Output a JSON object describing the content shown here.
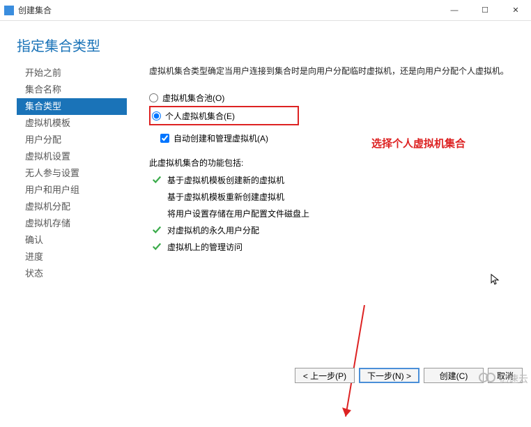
{
  "titlebar": {
    "title": "创建集合"
  },
  "winControls": {
    "min": "—",
    "max": "☐",
    "close": "✕"
  },
  "header": {
    "title": "指定集合类型"
  },
  "nav": {
    "items": [
      {
        "label": "开始之前"
      },
      {
        "label": "集合名称"
      },
      {
        "label": "集合类型"
      },
      {
        "label": "虚拟机模板"
      },
      {
        "label": "用户分配"
      },
      {
        "label": "虚拟机设置"
      },
      {
        "label": "无人参与设置"
      },
      {
        "label": "用户和用户组"
      },
      {
        "label": "虚拟机分配"
      },
      {
        "label": "虚拟机存储"
      },
      {
        "label": "确认"
      },
      {
        "label": "进度"
      },
      {
        "label": "状态"
      }
    ],
    "activeIndex": 2
  },
  "content": {
    "desc": "虚拟机集合类型确定当用户连接到集合时是向用户分配临时虚拟机，还是向用户分配个人虚拟机。",
    "radio1": "虚拟机集合池(O)",
    "radio2": "个人虚拟机集合(E)",
    "checkbox": "自动创建和管理虚拟机(A)",
    "featuresTitle": "此虚拟机集合的功能包括:",
    "features": [
      {
        "tick": true,
        "text": "基于虚拟机模板创建新的虚拟机"
      },
      {
        "tick": false,
        "text": "基于虚拟机模板重新创建虚拟机"
      },
      {
        "tick": false,
        "text": "将用户设置存储在用户配置文件磁盘上"
      },
      {
        "tick": true,
        "text": "对虚拟机的永久用户分配"
      },
      {
        "tick": true,
        "text": "虚拟机上的管理访问"
      }
    ]
  },
  "annotation": "选择个人虚拟机集合",
  "buttons": {
    "prev": "< 上一步(P)",
    "next": "下一步(N) >",
    "create": "创建(C)",
    "cancel": "取消"
  },
  "watermark": "亿速云"
}
